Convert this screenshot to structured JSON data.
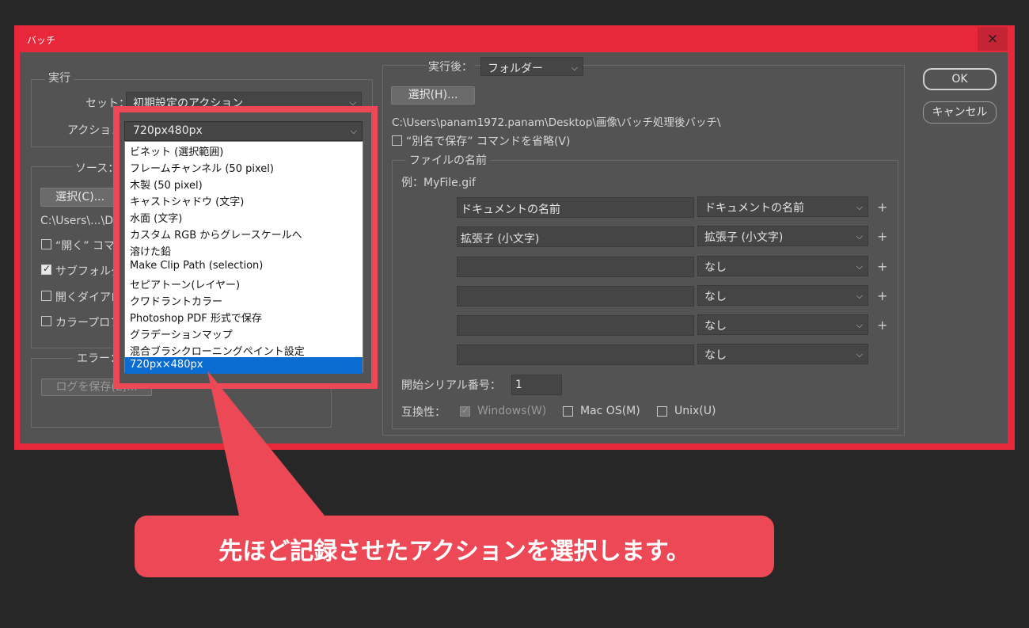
{
  "window": {
    "title": "バッチ",
    "close_glyph": "×"
  },
  "run": {
    "legend": "実行",
    "set_label": "セット：",
    "set_value": "初期設定のアクション",
    "action_label": "アクション",
    "action_value": "720px480px"
  },
  "source": {
    "legend": "ソース：",
    "choose_button": "選択(C)...",
    "path_prefix": "C:\\Users\\...\\De",
    "checkboxes": [
      {
        "label": "“開く” コマン",
        "checked": false
      },
      {
        "label": "サブフォルダ",
        "checked": true
      },
      {
        "label": "開くダイアロ",
        "checked": false
      },
      {
        "label": "カラープロフ",
        "checked": false
      }
    ]
  },
  "error": {
    "legend": "エラー：",
    "save_log_button": "ログを保存(E)..."
  },
  "action_dropdown": {
    "items": [
      "ビネット (選択範囲)",
      "フレームチャンネル (50 pixel)",
      "木製 (50 pixel)",
      "キャストシャドウ (文字)",
      "水面 (文字)",
      "カスタム RGB からグレースケールへ",
      "溶けた鉛",
      "Make Clip Path (selection)",
      "セピアトーン(レイヤー)",
      "クワドラントカラー",
      "Photoshop PDF 形式で保存",
      "グラデーションマップ",
      "混合ブラシクローニングペイント設定",
      "720px×480px"
    ],
    "selected_index": 13
  },
  "destination": {
    "label": "実行後：",
    "value": "フォルダー",
    "choose_button": "選択(H)...",
    "path": "C:\\Users\\panam1972.panam\\Desktop\\画像\\バッチ処理後バッチ\\",
    "override_save_as_label": "“別名で保存” コマンドを省略(V)",
    "override_checked": false
  },
  "file_naming": {
    "legend": "ファイルの名前",
    "example": "例：MyFile.gif",
    "rows": [
      {
        "field": "ドキュメントの名前",
        "option": "ドキュメントの名前",
        "plus": "+"
      },
      {
        "field": "拡張子 (小文字)",
        "option": "拡張子 (小文字)",
        "plus": "+"
      },
      {
        "field": "",
        "option": "なし",
        "plus": "+"
      },
      {
        "field": "",
        "option": "なし",
        "plus": "+"
      },
      {
        "field": "",
        "option": "なし",
        "plus": "+"
      },
      {
        "field": "",
        "option": "なし",
        "plus": ""
      }
    ],
    "serial_label": "開始シリアル番号：",
    "serial_value": "1",
    "compat_label": "互換性：",
    "compat": [
      {
        "label": "Windows(W)",
        "checked": true,
        "disabled": true
      },
      {
        "label": "Mac OS(M)",
        "checked": false,
        "disabled": false
      },
      {
        "label": "Unix(U)",
        "checked": false,
        "disabled": false
      }
    ]
  },
  "buttons": {
    "ok": "OK",
    "cancel": "キャンセル"
  },
  "callout": {
    "text": "先ほど記録させたアクションを選択します。"
  },
  "colors": {
    "accent_red": "#e8273a",
    "callout_red": "#ec4856",
    "selection_blue": "#0a6bd0"
  }
}
